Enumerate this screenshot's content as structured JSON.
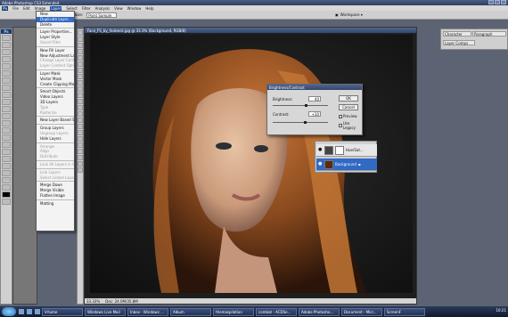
{
  "window": {
    "title": "Adobe Photoshop CS3 Extended"
  },
  "menubar": {
    "logo": "Ps",
    "items": [
      "File",
      "Edit",
      "Image",
      "Layer",
      "Select",
      "Filter",
      "Analysis",
      "View",
      "Window",
      "Help"
    ],
    "active": "Layer"
  },
  "options": {
    "sample_size_label": "Sample Size:",
    "sample_size_value": "Point Sample",
    "workspace_label": "Workspace ▾"
  },
  "document": {
    "title": "Face_FS_by_fanbeck.jpg @ 33.3% (Background, RGB/8)",
    "zoom": "33.33%",
    "doc_size": "Doc: 24.0M/35.8M"
  },
  "layer_menu": [
    {
      "label": "New",
      "state": "normal"
    },
    {
      "label": "Duplicate Layer...",
      "state": "highlight"
    },
    {
      "label": "Delete",
      "state": "normal"
    },
    {
      "sep": true
    },
    {
      "label": "Layer Properties...",
      "state": "normal"
    },
    {
      "label": "Layer Style",
      "state": "normal"
    },
    {
      "label": "Smart Filter",
      "state": "disabled"
    },
    {
      "sep": true
    },
    {
      "label": "New Fill Layer",
      "state": "normal"
    },
    {
      "label": "New Adjustment Layer",
      "state": "normal"
    },
    {
      "label": "Change Layer Content",
      "state": "disabled"
    },
    {
      "label": "Layer Content Options...",
      "state": "disabled"
    },
    {
      "sep": true
    },
    {
      "label": "Layer Mask",
      "state": "normal"
    },
    {
      "label": "Vector Mask",
      "state": "normal"
    },
    {
      "label": "Create Clipping Mask",
      "state": "normal"
    },
    {
      "sep": true
    },
    {
      "label": "Smart Objects",
      "state": "normal"
    },
    {
      "label": "Video Layers",
      "state": "normal"
    },
    {
      "label": "3D Layers",
      "state": "normal"
    },
    {
      "label": "Type",
      "state": "disabled"
    },
    {
      "label": "Rasterize",
      "state": "disabled"
    },
    {
      "sep": true
    },
    {
      "label": "New Layer Based Slice",
      "state": "normal"
    },
    {
      "sep": true
    },
    {
      "label": "Group Layers",
      "state": "normal"
    },
    {
      "label": "Ungroup Layers",
      "state": "disabled"
    },
    {
      "label": "Hide Layers",
      "state": "normal"
    },
    {
      "sep": true
    },
    {
      "label": "Arrange",
      "state": "disabled"
    },
    {
      "label": "Align",
      "state": "disabled"
    },
    {
      "label": "Distribute",
      "state": "disabled"
    },
    {
      "sep": true
    },
    {
      "label": "Lock All Layers in Group...",
      "state": "disabled"
    },
    {
      "sep": true
    },
    {
      "label": "Link Layers",
      "state": "disabled"
    },
    {
      "label": "Select Linked Layers",
      "state": "disabled"
    },
    {
      "sep": true
    },
    {
      "label": "Merge Down",
      "state": "normal"
    },
    {
      "label": "Merge Visible",
      "state": "normal"
    },
    {
      "label": "Flatten Image",
      "state": "normal"
    },
    {
      "sep": true
    },
    {
      "label": "Matting",
      "state": "normal"
    }
  ],
  "dialog": {
    "title": "Brightness/Contrast",
    "brightness_label": "Brightness:",
    "brightness_value": "40",
    "contrast_label": "Contrast:",
    "contrast_value": "+30",
    "brightness_level": 0.6,
    "contrast_level": 0.58,
    "ok_label": "OK",
    "cancel_label": "Cancel",
    "preview_label": "Preview",
    "legacy_label": "Use Legacy",
    "preview_checked": true,
    "legacy_checked": false
  },
  "panels": {
    "character_tab": "Character",
    "paragraph_tab": "Paragraph",
    "layer_comps_tab": "Layer Comps"
  },
  "layers": [
    {
      "name": "Hue/Sat...",
      "selected": false
    },
    {
      "name": "Background",
      "selected": true
    }
  ],
  "taskbar": {
    "items": [
      "Vrlume",
      "Windows Live Mail",
      "Inbox - Windows ...",
      "Album",
      "themaspilation",
      "combat - ACDSe...",
      "Adobe Photosho...",
      "Document - Micr...",
      "ScreenF"
    ],
    "clock": "10:21"
  }
}
